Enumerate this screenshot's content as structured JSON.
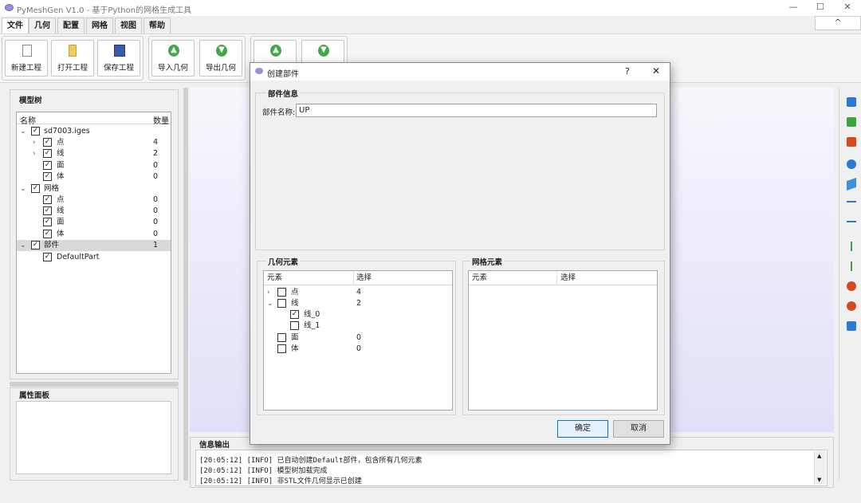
{
  "window": {
    "title": "PyMeshGen V1.0 - 基于Python的网格生成工具",
    "minimize": "—",
    "maximize": "☐",
    "close": "✕"
  },
  "menu": {
    "tabs": [
      "文件",
      "几何",
      "配置",
      "网格",
      "视图",
      "帮助"
    ],
    "collapse": "^"
  },
  "toolbar": {
    "new": "新建工程",
    "open": "打开工程",
    "save": "保存工程",
    "import": "导入几何",
    "export": "导出几何"
  },
  "model_tree": {
    "title": "模型树",
    "headers": {
      "name": "名称",
      "count": "数量"
    },
    "rows": [
      {
        "label": "sd7003.iges",
        "count": ""
      },
      {
        "label": "点",
        "count": "4"
      },
      {
        "label": "线",
        "count": "2"
      },
      {
        "label": "面",
        "count": "0"
      },
      {
        "label": "体",
        "count": "0"
      },
      {
        "label": "网格",
        "count": ""
      },
      {
        "label": "点",
        "count": "0"
      },
      {
        "label": "线",
        "count": "0"
      },
      {
        "label": "面",
        "count": "0"
      },
      {
        "label": "体",
        "count": "0"
      },
      {
        "label": "部件",
        "count": "1"
      },
      {
        "label": "DefaultPart",
        "count": ""
      }
    ]
  },
  "properties": {
    "title": "属性面板"
  },
  "info_output": {
    "title": "信息输出",
    "lines": [
      "[20:05:12] [INFO] 已自动创建Default部件，包含所有几何元素",
      "[20:05:12] [INFO] 模型树加载完成",
      "[20:05:12] [INFO] 非STL文件几何显示已创建"
    ]
  },
  "dialog": {
    "title": "创建部件",
    "help": "?",
    "close": "✕",
    "part_info_title": "部件信息",
    "part_name_label": "部件名称:",
    "part_name_value": "UP",
    "geom_title": "几何元素",
    "mesh_title": "网格元素",
    "geom_headers": {
      "element": "元素",
      "select": "选择"
    },
    "geom_rows": [
      {
        "label": "点",
        "count": "4"
      },
      {
        "label": "线",
        "count": "2"
      },
      {
        "label": "线_0",
        "count": ""
      },
      {
        "label": "线_1",
        "count": ""
      },
      {
        "label": "面",
        "count": "0"
      },
      {
        "label": "体",
        "count": "0"
      }
    ],
    "mesh_headers": {
      "element": "元素",
      "select": "选择"
    },
    "ok": "确定",
    "cancel": "取消"
  },
  "checkmark": "✓",
  "icons": {
    "expand": "›",
    "collapse": "⌄",
    "up": "▲",
    "down": "▼"
  }
}
